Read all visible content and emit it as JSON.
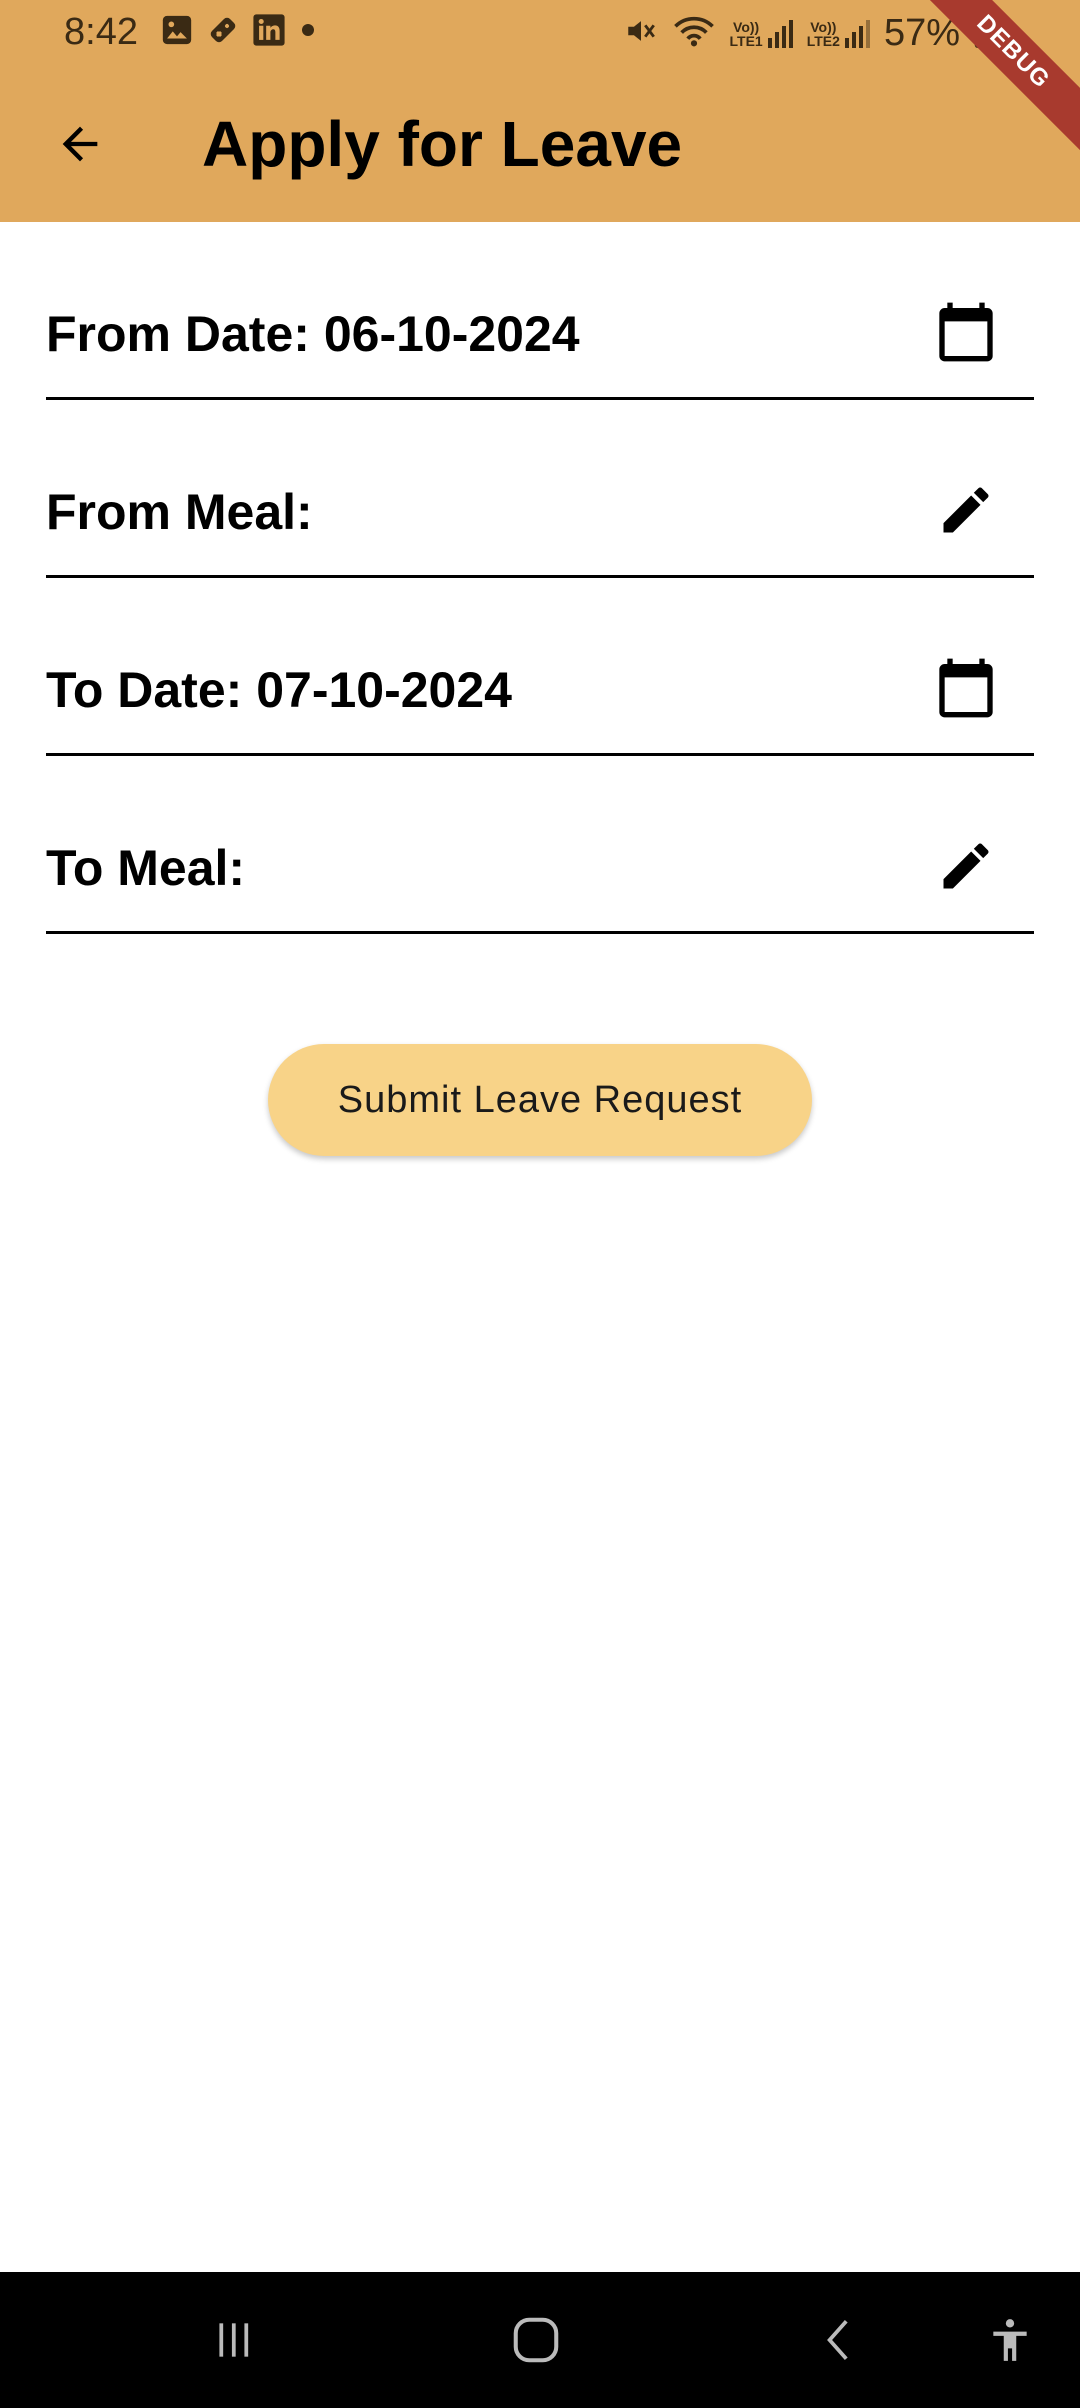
{
  "status_bar": {
    "time": "8:42",
    "battery": "57%",
    "left_icons": [
      "gallery-icon",
      "game-icon",
      "linkedin-icon",
      "dot-icon"
    ],
    "right_icons": [
      "mute-icon",
      "wifi-icon",
      "signal-lte1-icon",
      "signal-lte2-icon",
      "battery-icon"
    ],
    "sim1_label_top": "Vo))",
    "sim1_label_bottom": "LTE1",
    "sim2_label_top": "Vo))",
    "sim2_label_bottom": "LTE2"
  },
  "debug_banner": "DEBUG",
  "app_bar": {
    "title": "Apply for Leave",
    "back_icon": "arrow-back-icon",
    "color": "#E0A85C"
  },
  "form": {
    "rows": [
      {
        "label": "From Date:",
        "value": "06-10-2024",
        "icon": "calendar-icon"
      },
      {
        "label": "From Meal:",
        "value": "",
        "icon": "edit-icon"
      },
      {
        "label": "To Date:",
        "value": "07-10-2024",
        "icon": "calendar-icon"
      },
      {
        "label": "To Meal:",
        "value": "",
        "icon": "edit-icon"
      }
    ]
  },
  "submit": {
    "label": "Submit Leave Request",
    "color": "#F8D388"
  },
  "nav_bar": {
    "icons": [
      "recent-apps-icon",
      "home-icon",
      "back-icon",
      "accessibility-icon"
    ]
  }
}
